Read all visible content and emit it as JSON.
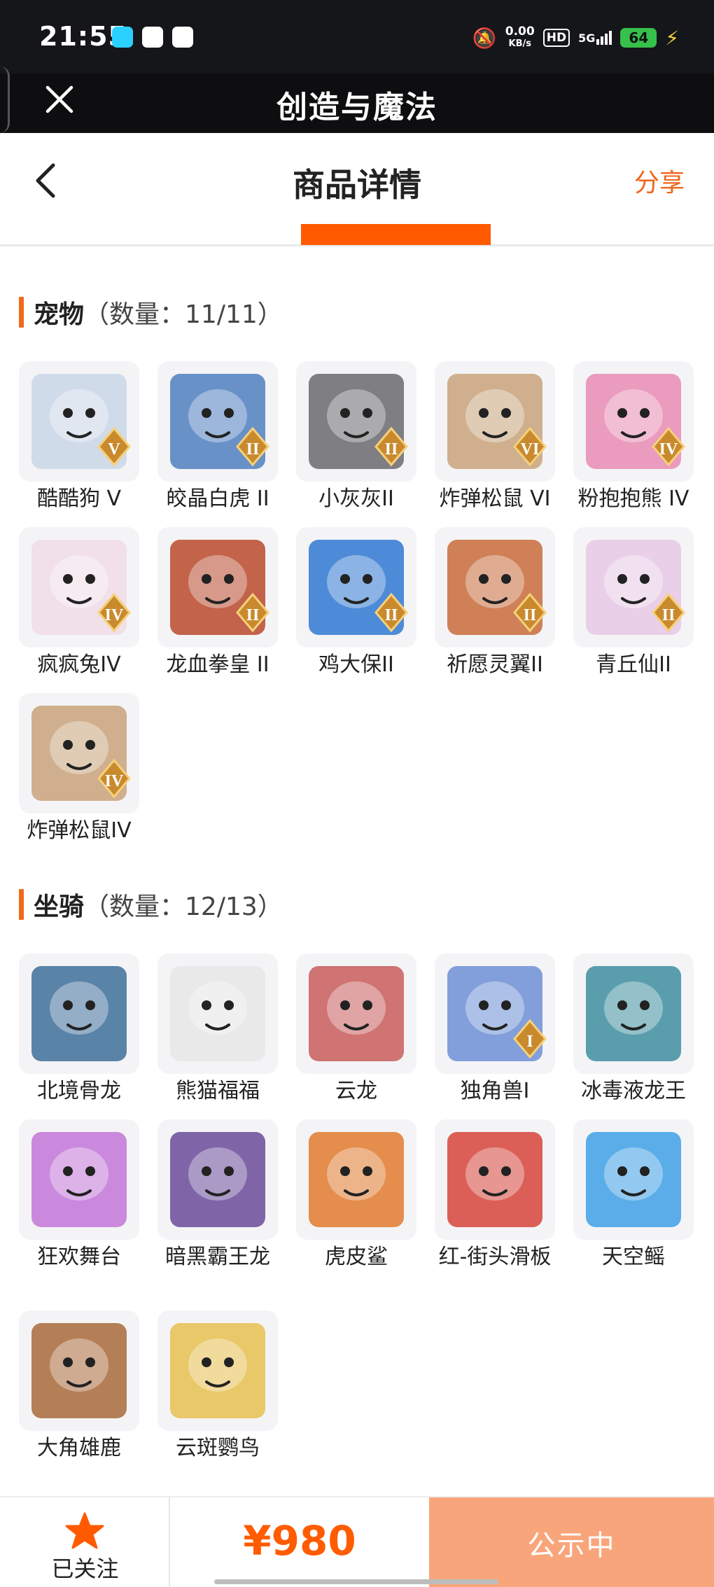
{
  "status_bar": {
    "time": "21:55",
    "speed_value": "0.00",
    "speed_unit": "KB/s",
    "hd": "HD",
    "network": "5G",
    "battery": "64"
  },
  "titlebar": {
    "title": "创造与魔法"
  },
  "header": {
    "title": "商品详情",
    "share_label": "分享"
  },
  "sections": [
    {
      "name": "宠物",
      "count": "（数量：11/11）",
      "items": [
        {
          "label": "酷酷狗 V",
          "badge": "V",
          "color": "#c9d6e8",
          "icon": "white-dog-icon"
        },
        {
          "label": "皎晶白虎 II",
          "badge": "II",
          "color": "#4f7fc0",
          "icon": "white-tiger-icon"
        },
        {
          "label": "小灰灰II",
          "badge": "II",
          "color": "#6a6a6e",
          "icon": "gray-dog-icon"
        },
        {
          "label": "炸弹松鼠 VI",
          "badge": "VI",
          "color": "#c8a27a",
          "icon": "bomb-squirrel-icon"
        },
        {
          "label": "粉抱抱熊 IV",
          "badge": "IV",
          "color": "#e88bb4",
          "icon": "pink-bear-icon"
        },
        {
          "label": "疯疯兔IV",
          "badge": "IV",
          "color": "#f0dce6",
          "icon": "crazy-rabbit-icon"
        },
        {
          "label": "龙血拳皇 II",
          "badge": "II",
          "color": "#b8492c",
          "icon": "dragon-blood-boxer-icon"
        },
        {
          "label": "鸡大保II",
          "badge": "II",
          "color": "#2f78d2",
          "icon": "blue-chicken-icon"
        },
        {
          "label": "祈愿灵翼II",
          "badge": "II",
          "color": "#c86b3a",
          "icon": "wish-wing-bird-icon"
        },
        {
          "label": "青丘仙II",
          "badge": "II",
          "color": "#e8c8e6",
          "icon": "fox-fairy-icon"
        },
        {
          "label": "炸弹松鼠IV",
          "badge": "IV",
          "color": "#c8a27a",
          "icon": "bomb-squirrel-icon"
        }
      ]
    },
    {
      "name": "坐骑",
      "count": "（数量：12/13）",
      "items": [
        {
          "label": "北境骨龙",
          "badge": "",
          "color": "#3e6f9a",
          "icon": "bone-dragon-icon"
        },
        {
          "label": "熊猫福福",
          "badge": "",
          "color": "#e6e6e6",
          "icon": "panda-icon"
        },
        {
          "label": "云龙",
          "badge": "",
          "color": "#c85c5c",
          "icon": "cloud-dragon-icon"
        },
        {
          "label": "独角兽I",
          "badge": "I",
          "color": "#6d8fd6",
          "icon": "unicorn-icon"
        },
        {
          "label": "冰毒液龙王",
          "badge": "",
          "color": "#3e8ea0",
          "icon": "ice-venom-dragon-icon"
        },
        {
          "label": "狂欢舞台",
          "badge": "",
          "color": "#c276d8",
          "icon": "carnival-stage-icon"
        },
        {
          "label": "暗黑霸王龙",
          "badge": "",
          "color": "#6a4b9a",
          "icon": "dark-trex-icon"
        },
        {
          "label": "虎皮鲨",
          "badge": "",
          "color": "#e07a2e",
          "icon": "tiger-shark-icon"
        },
        {
          "label": "红-街头滑板",
          "badge": "",
          "color": "#d6443a",
          "icon": "skateboard-icon"
        },
        {
          "label": "天空鳐",
          "badge": "",
          "color": "#3ea0e6",
          "icon": "sky-ray-icon"
        },
        {
          "label": "大角雄鹿",
          "badge": "",
          "color": "#a86a3a",
          "icon": "stag-icon"
        },
        {
          "label": "云斑鹦鸟",
          "badge": "",
          "color": "#e6c050",
          "icon": "parrot-icon"
        }
      ]
    }
  ],
  "bottom_bar": {
    "follow_label": "已关注",
    "price": "¥980",
    "status_label": "公示中"
  }
}
